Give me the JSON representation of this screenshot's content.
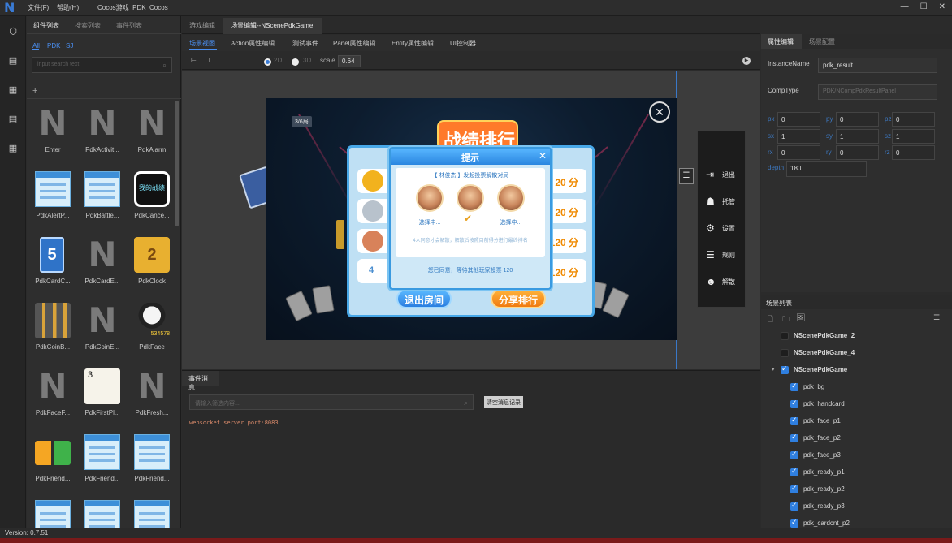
{
  "app": {
    "window_title": "Cocos游戏_PDK_Cocos",
    "menu": [
      "文件(F)",
      "帮助(H)"
    ],
    "window_controls": [
      "—",
      "☐",
      "✕"
    ],
    "version": "Version: 0.7.51"
  },
  "rail_icons": [
    "cube-icon",
    "document-icon",
    "grid-icon",
    "list-icon",
    "grid-icon"
  ],
  "left_panel": {
    "tabs": [
      "组件列表",
      "搜索列表",
      "事件列表"
    ],
    "filters": [
      "All",
      "PDK",
      "SJ"
    ],
    "search_placeholder": "input search text",
    "add_label": "+",
    "components": [
      {
        "label": "Enter",
        "kind": "n"
      },
      {
        "label": "PdkActivit...",
        "kind": "n"
      },
      {
        "label": "PdkAlarm",
        "kind": "n"
      },
      {
        "label": "PdkAlertP...",
        "kind": "panel"
      },
      {
        "label": "PdkBattle...",
        "kind": "panel"
      },
      {
        "label": "PdkCance...",
        "kind": "cancel"
      },
      {
        "label": "PdkCardC...",
        "kind": "card5"
      },
      {
        "label": "PdkCardE...",
        "kind": "n"
      },
      {
        "label": "PdkClock",
        "kind": "clock"
      },
      {
        "label": "PdkCoinB...",
        "kind": "coinbar"
      },
      {
        "label": "PdkCoinE...",
        "kind": "n"
      },
      {
        "label": "PdkFace",
        "kind": "face"
      },
      {
        "label": "PdkFaceF...",
        "kind": "n"
      },
      {
        "label": "PdkFirstPl...",
        "kind": "spade"
      },
      {
        "label": "PdkFresh...",
        "kind": "n"
      },
      {
        "label": "PdkFriend...",
        "kind": "friend1"
      },
      {
        "label": "PdkFriend...",
        "kind": "panel"
      },
      {
        "label": "PdkFriend...",
        "kind": "panel"
      },
      {
        "label": "",
        "kind": "panel"
      },
      {
        "label": "",
        "kind": "panel"
      },
      {
        "label": "",
        "kind": "panel"
      }
    ],
    "thumb_texts": {
      "card_number": "5",
      "clock_number": "2",
      "spade_rank": "3",
      "face_coins": "534578",
      "cancel_text": "我的战绩",
      "n_letter": "N"
    }
  },
  "center": {
    "tabs": [
      "游戏编辑",
      "场景编辑--NScenePdkGame"
    ],
    "active_tab": 1,
    "sub_tabs": [
      "场景视图",
      "Action属性编辑",
      "测试事件",
      "Panel属性编辑",
      "Entity属性编辑",
      "UI控制器"
    ],
    "toolbar": {
      "mode_2d": "2D",
      "mode_3d": "3D",
      "scale_label": "scale",
      "scale_value": "0.64"
    }
  },
  "game_scene": {
    "room_count": "3/6局",
    "rank_title": "战绩排行",
    "rank_rows": [
      {
        "rank": "",
        "medal_color": "#f2b21e",
        "score": "20 分"
      },
      {
        "rank": "",
        "medal_color": "#b8c2cc",
        "score": "20 分"
      },
      {
        "rank": "",
        "medal_color": "#d8825a",
        "score": "120 分"
      },
      {
        "rank": "4",
        "medal_color": "",
        "score": "120 分"
      }
    ],
    "exit_button": "退出房间",
    "share_button": "分享排行",
    "tip": {
      "title": "提示",
      "close": "✕",
      "line1": "【 林俊杰 】发起投票解散对局",
      "avatars": [
        "选择中...",
        "",
        "选择中..."
      ],
      "line2": "4人同意才会解散，解散后按照目前得分进行最终排名",
      "line3": "您已同意，等待其他玩家投票    120"
    },
    "side_menu": [
      {
        "icon": "exit-icon",
        "glyph": "⇥",
        "label": "退出"
      },
      {
        "icon": "robot-icon",
        "glyph": "☗",
        "label": "托管"
      },
      {
        "icon": "gear-icon",
        "glyph": "⚙",
        "label": "设置"
      },
      {
        "icon": "rules-icon",
        "glyph": "☰",
        "label": "规则"
      },
      {
        "icon": "dissolve-icon",
        "glyph": "☻",
        "label": "解散"
      }
    ]
  },
  "messages": {
    "tab": "事件消息",
    "input_placeholder": "请输入筛选内容...",
    "clear_button": "清空消息记录",
    "log": [
      "websocket server port:8083"
    ]
  },
  "properties": {
    "tabs": [
      "属性编辑",
      "场景配置"
    ],
    "instance_name_label": "InstanceName",
    "instance_name_value": "pdk_result",
    "comp_type_label": "CompType",
    "comp_type_value": "PDK/NCompPdkResultPanel",
    "transform": [
      {
        "label": "px",
        "value": "0"
      },
      {
        "label": "py",
        "value": "0"
      },
      {
        "label": "pz",
        "value": "0"
      },
      {
        "label": "sx",
        "value": "1"
      },
      {
        "label": "sy",
        "value": "1"
      },
      {
        "label": "sz",
        "value": "1"
      },
      {
        "label": "rx",
        "value": "0"
      },
      {
        "label": "ry",
        "value": "0"
      },
      {
        "label": "rz",
        "value": "0"
      }
    ],
    "depth_label": "depth",
    "depth_value": "180"
  },
  "scene_list": {
    "title": "场景列表",
    "tools": [
      "new-file-icon",
      "folder-icon",
      "image-icon",
      "menu-icon"
    ],
    "tool_glyphs": [
      "🗋",
      "🗀",
      "🖼",
      "☰"
    ],
    "items": [
      {
        "label": "NScenePdkGame_2",
        "checked": false,
        "bold": true,
        "level": 0,
        "expander": false
      },
      {
        "label": "NScenePdkGame_4",
        "checked": false,
        "bold": true,
        "level": 0,
        "expander": false
      },
      {
        "label": "NScenePdkGame",
        "checked": true,
        "bold": true,
        "level": 0,
        "expander": true
      },
      {
        "label": "pdk_bg",
        "checked": true,
        "bold": false,
        "level": 1
      },
      {
        "label": "pdk_handcard",
        "checked": true,
        "bold": false,
        "level": 1
      },
      {
        "label": "pdk_face_p1",
        "checked": true,
        "bold": false,
        "level": 1
      },
      {
        "label": "pdk_face_p2",
        "checked": true,
        "bold": false,
        "level": 1
      },
      {
        "label": "pdk_face_p3",
        "checked": true,
        "bold": false,
        "level": 1
      },
      {
        "label": "pdk_ready_p1",
        "checked": true,
        "bold": false,
        "level": 1
      },
      {
        "label": "pdk_ready_p2",
        "checked": true,
        "bold": false,
        "level": 1
      },
      {
        "label": "pdk_ready_p3",
        "checked": true,
        "bold": false,
        "level": 1
      },
      {
        "label": "pdk_cardcnt_p2",
        "checked": true,
        "bold": false,
        "level": 1
      }
    ]
  },
  "colors": {
    "accent": "#3a7bd5",
    "active_tab_text": "#4a8ef0",
    "log_text": "#d98a6a"
  }
}
